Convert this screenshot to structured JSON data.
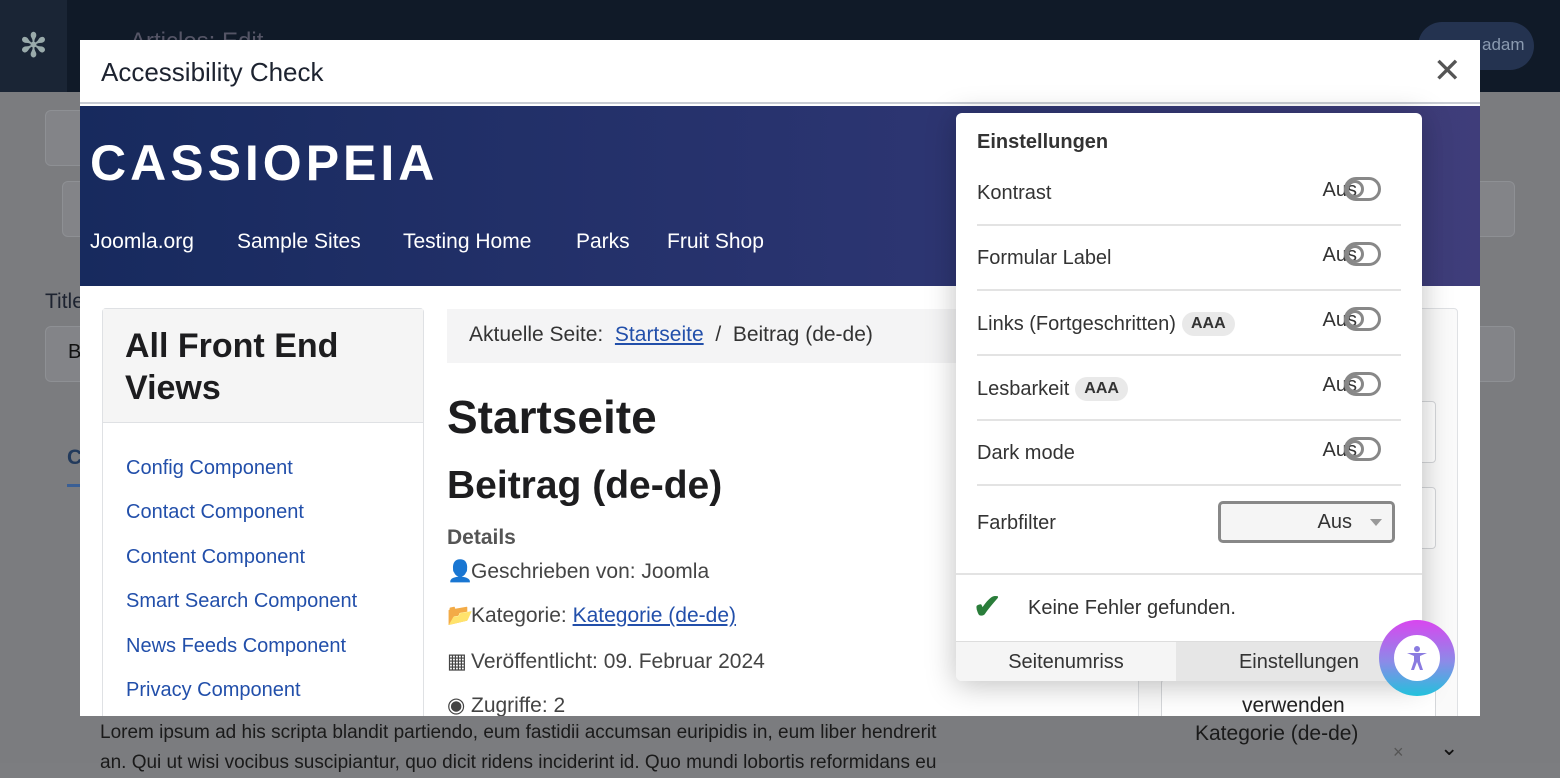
{
  "admin": {
    "title": "Articles: Edit",
    "user": "adam",
    "title_label": "Title",
    "title_value_initial": "B",
    "tab_initial": "C"
  },
  "background": {
    "lorem": "Lorem ipsum ad his scripta blandit partiendo, eum fastidii accumsan euripidis in, eum liber hendrerit",
    "lorem2": "an. Qui ut wisi vocibus suscipiantur, quo dicit ridens inciderint id. Quo mundi lobortis reformidans eu",
    "category": "Kategorie (de-de)",
    "remove": "×"
  },
  "modal": {
    "title": "Accessibility Check",
    "close": "✕"
  },
  "site": {
    "brand": "CASSIOPEIA",
    "nav": [
      "Joomla.org",
      "Sample Sites",
      "Testing Home",
      "Parks",
      "Fruit Shop"
    ],
    "sidebar_title": "All Front End Views",
    "sidebar_links": [
      "Config Component",
      "Contact Component",
      "Content Component",
      "Smart Search Component",
      "News Feeds Component",
      "Privacy Component"
    ],
    "breadcrumb": {
      "label": "Aktuelle Seite:",
      "home": "Startseite",
      "sep": "/",
      "current": "Beitrag (de-de)"
    },
    "page_heading": "Startseite",
    "article_title": "Beitrag (de-de)",
    "details_label": "Details",
    "author": "Geschrieben von: Joomla",
    "category_label": "Kategorie:",
    "category_link": "Kategorie (de-de)",
    "published": "Veröffentlicht: 09. Februar 2024",
    "hits": "Zugriffe: 2",
    "right_text": "verwenden"
  },
  "panel": {
    "title": "Einstellungen",
    "rows": [
      {
        "label": "Kontrast",
        "badge": "",
        "state": "Aus"
      },
      {
        "label": "Formular Label",
        "badge": "",
        "state": "Aus"
      },
      {
        "label": "Links (Fortgeschritten)",
        "badge": "AAA",
        "state": "Aus"
      },
      {
        "label": "Lesbarkeit",
        "badge": "AAA",
        "state": "Aus"
      },
      {
        "label": "Dark mode",
        "badge": "",
        "state": "Aus"
      }
    ],
    "filter": {
      "label": "Farbfilter",
      "value": "Aus"
    },
    "status": "Keine Fehler gefunden.",
    "tabs": {
      "outline": "Seitenumriss",
      "settings": "Einstellungen"
    },
    "colors": {
      "success": "#2a7d3a",
      "header_start": "#172a5e",
      "header_end": "#3f3d7a"
    }
  }
}
